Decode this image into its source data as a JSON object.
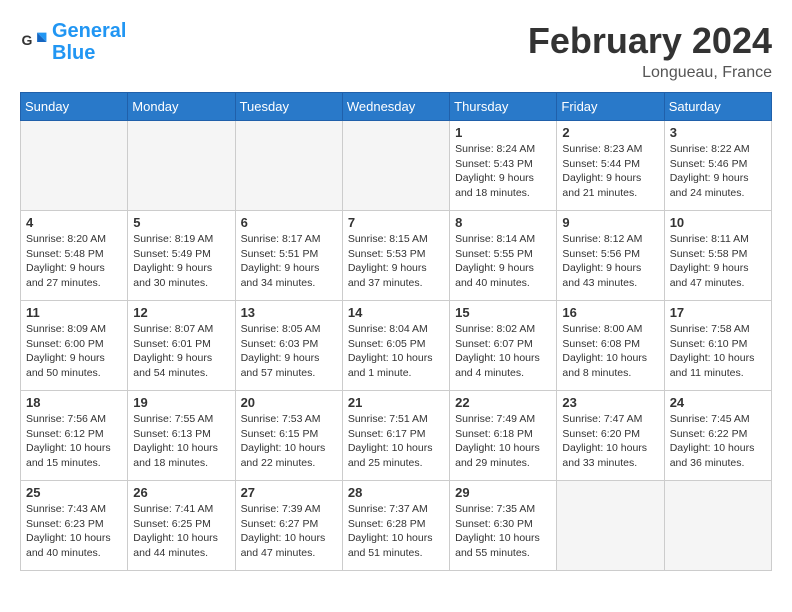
{
  "header": {
    "logo_general": "General",
    "logo_blue": "Blue",
    "title": "February 2024",
    "subtitle": "Longueau, France"
  },
  "days_of_week": [
    "Sunday",
    "Monday",
    "Tuesday",
    "Wednesday",
    "Thursday",
    "Friday",
    "Saturday"
  ],
  "weeks": [
    [
      {
        "day": "",
        "info": ""
      },
      {
        "day": "",
        "info": ""
      },
      {
        "day": "",
        "info": ""
      },
      {
        "day": "",
        "info": ""
      },
      {
        "day": "1",
        "info": "Sunrise: 8:24 AM\nSunset: 5:43 PM\nDaylight: 9 hours and 18 minutes."
      },
      {
        "day": "2",
        "info": "Sunrise: 8:23 AM\nSunset: 5:44 PM\nDaylight: 9 hours and 21 minutes."
      },
      {
        "day": "3",
        "info": "Sunrise: 8:22 AM\nSunset: 5:46 PM\nDaylight: 9 hours and 24 minutes."
      }
    ],
    [
      {
        "day": "4",
        "info": "Sunrise: 8:20 AM\nSunset: 5:48 PM\nDaylight: 9 hours and 27 minutes."
      },
      {
        "day": "5",
        "info": "Sunrise: 8:19 AM\nSunset: 5:49 PM\nDaylight: 9 hours and 30 minutes."
      },
      {
        "day": "6",
        "info": "Sunrise: 8:17 AM\nSunset: 5:51 PM\nDaylight: 9 hours and 34 minutes."
      },
      {
        "day": "7",
        "info": "Sunrise: 8:15 AM\nSunset: 5:53 PM\nDaylight: 9 hours and 37 minutes."
      },
      {
        "day": "8",
        "info": "Sunrise: 8:14 AM\nSunset: 5:55 PM\nDaylight: 9 hours and 40 minutes."
      },
      {
        "day": "9",
        "info": "Sunrise: 8:12 AM\nSunset: 5:56 PM\nDaylight: 9 hours and 43 minutes."
      },
      {
        "day": "10",
        "info": "Sunrise: 8:11 AM\nSunset: 5:58 PM\nDaylight: 9 hours and 47 minutes."
      }
    ],
    [
      {
        "day": "11",
        "info": "Sunrise: 8:09 AM\nSunset: 6:00 PM\nDaylight: 9 hours and 50 minutes."
      },
      {
        "day": "12",
        "info": "Sunrise: 8:07 AM\nSunset: 6:01 PM\nDaylight: 9 hours and 54 minutes."
      },
      {
        "day": "13",
        "info": "Sunrise: 8:05 AM\nSunset: 6:03 PM\nDaylight: 9 hours and 57 minutes."
      },
      {
        "day": "14",
        "info": "Sunrise: 8:04 AM\nSunset: 6:05 PM\nDaylight: 10 hours and 1 minute."
      },
      {
        "day": "15",
        "info": "Sunrise: 8:02 AM\nSunset: 6:07 PM\nDaylight: 10 hours and 4 minutes."
      },
      {
        "day": "16",
        "info": "Sunrise: 8:00 AM\nSunset: 6:08 PM\nDaylight: 10 hours and 8 minutes."
      },
      {
        "day": "17",
        "info": "Sunrise: 7:58 AM\nSunset: 6:10 PM\nDaylight: 10 hours and 11 minutes."
      }
    ],
    [
      {
        "day": "18",
        "info": "Sunrise: 7:56 AM\nSunset: 6:12 PM\nDaylight: 10 hours and 15 minutes."
      },
      {
        "day": "19",
        "info": "Sunrise: 7:55 AM\nSunset: 6:13 PM\nDaylight: 10 hours and 18 minutes."
      },
      {
        "day": "20",
        "info": "Sunrise: 7:53 AM\nSunset: 6:15 PM\nDaylight: 10 hours and 22 minutes."
      },
      {
        "day": "21",
        "info": "Sunrise: 7:51 AM\nSunset: 6:17 PM\nDaylight: 10 hours and 25 minutes."
      },
      {
        "day": "22",
        "info": "Sunrise: 7:49 AM\nSunset: 6:18 PM\nDaylight: 10 hours and 29 minutes."
      },
      {
        "day": "23",
        "info": "Sunrise: 7:47 AM\nSunset: 6:20 PM\nDaylight: 10 hours and 33 minutes."
      },
      {
        "day": "24",
        "info": "Sunrise: 7:45 AM\nSunset: 6:22 PM\nDaylight: 10 hours and 36 minutes."
      }
    ],
    [
      {
        "day": "25",
        "info": "Sunrise: 7:43 AM\nSunset: 6:23 PM\nDaylight: 10 hours and 40 minutes."
      },
      {
        "day": "26",
        "info": "Sunrise: 7:41 AM\nSunset: 6:25 PM\nDaylight: 10 hours and 44 minutes."
      },
      {
        "day": "27",
        "info": "Sunrise: 7:39 AM\nSunset: 6:27 PM\nDaylight: 10 hours and 47 minutes."
      },
      {
        "day": "28",
        "info": "Sunrise: 7:37 AM\nSunset: 6:28 PM\nDaylight: 10 hours and 51 minutes."
      },
      {
        "day": "29",
        "info": "Sunrise: 7:35 AM\nSunset: 6:30 PM\nDaylight: 10 hours and 55 minutes."
      },
      {
        "day": "",
        "info": ""
      },
      {
        "day": "",
        "info": ""
      }
    ]
  ]
}
